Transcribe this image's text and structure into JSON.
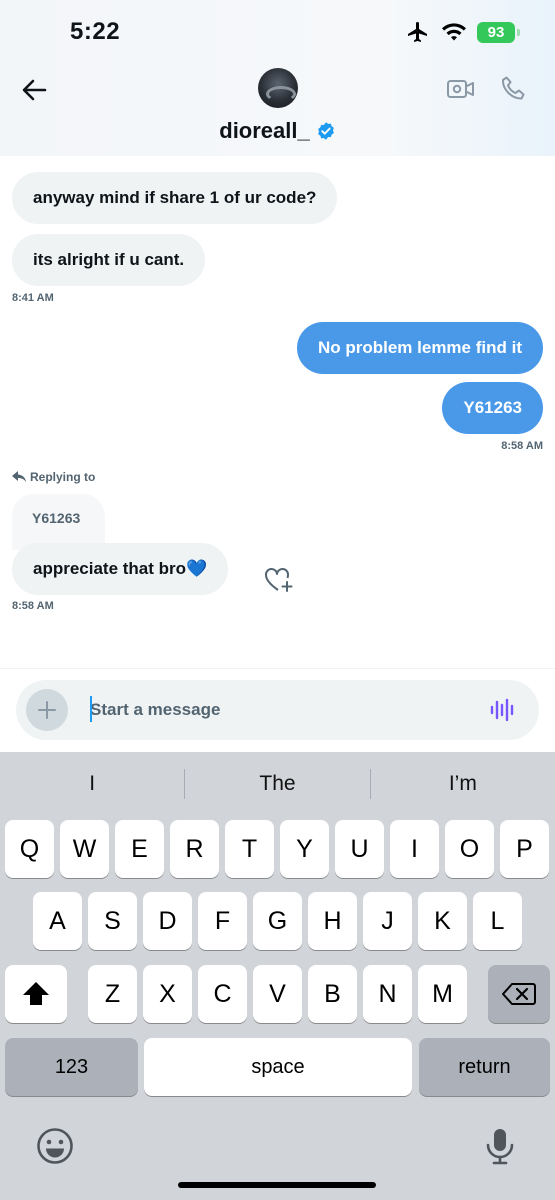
{
  "status": {
    "time": "5:22",
    "battery": "93"
  },
  "header": {
    "name": "dioreall_"
  },
  "messages": [
    {
      "text": "anyway mind if share 1 of ur code?"
    },
    {
      "text": "its alright if u cant."
    },
    {
      "text": "No problem lemme find it"
    },
    {
      "text": "Y61263"
    },
    {
      "text": "appreciate that bro💙"
    }
  ],
  "timestamps": [
    "8:41 AM",
    "8:58 AM",
    "8:58 AM"
  ],
  "reply": {
    "label": "Replying to",
    "quoted": "Y61263"
  },
  "composer": {
    "placeholder": "Start a message"
  },
  "keyboard": {
    "suggestions": [
      "I",
      "The",
      "I’m"
    ],
    "row1": [
      "Q",
      "W",
      "E",
      "R",
      "T",
      "Y",
      "U",
      "I",
      "O",
      "P"
    ],
    "row2": [
      "A",
      "S",
      "D",
      "F",
      "G",
      "H",
      "J",
      "K",
      "L"
    ],
    "row3": [
      "Z",
      "X",
      "C",
      "V",
      "B",
      "N",
      "M"
    ],
    "numbers_key": "123",
    "space_key": "space",
    "return_key": "return"
  },
  "colors": {
    "accent": "#4a99e9",
    "bubble_in": "#eff3f4",
    "battery": "#34c759",
    "voice": "#7856ff"
  }
}
